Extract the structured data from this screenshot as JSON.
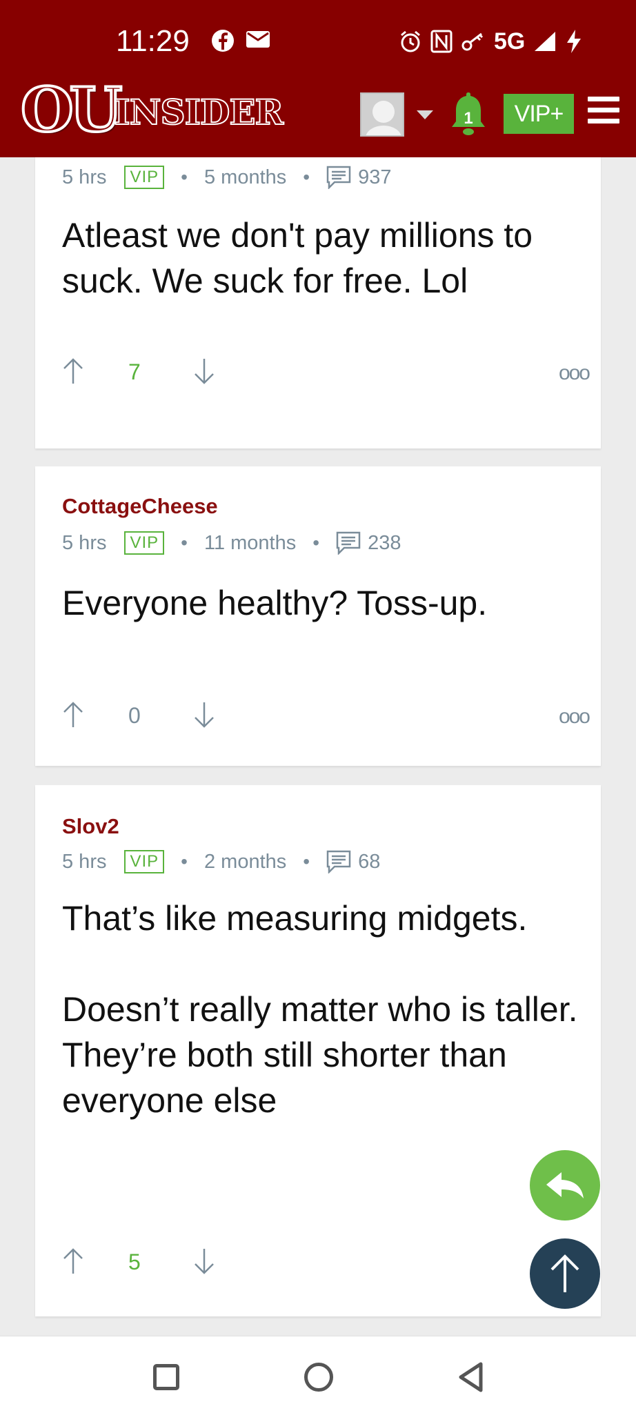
{
  "status_bar": {
    "time": "11:29",
    "left_icons": [
      "facebook-icon",
      "mail-icon"
    ],
    "right_icons": [
      "alarm-icon",
      "nfc-icon",
      "key-icon",
      "5g-signal-icon",
      "charging-icon"
    ],
    "network": "5G"
  },
  "app_bar": {
    "logo_ou": "OU",
    "logo_insider": "INSIDER",
    "notification_count": "1",
    "vip_label": "VIP+",
    "colors": {
      "brand": "#870000",
      "vip_green": "#59b33c"
    }
  },
  "comments": [
    {
      "author": "",
      "posted": "5 hrs",
      "badge": "VIP",
      "tenure": "5 months",
      "post_count": "937",
      "body": "Atleast we don't pay millions to suck. We suck for free. Lol",
      "votes": "7",
      "vote_color": "#59b33c",
      "more_label": "ooo"
    },
    {
      "author": "CottageCheese",
      "posted": "5 hrs",
      "badge": "VIP",
      "tenure": "11 months",
      "post_count": "238",
      "body": "Everyone healthy? Toss-up.",
      "votes": "0",
      "vote_color": "#7a8c99",
      "more_label": "ooo"
    },
    {
      "author": "Slov2",
      "posted": "5 hrs",
      "badge": "VIP",
      "tenure": "2 months",
      "post_count": "68",
      "body": "That’s like measuring midgets.\n\nDoesn’t really matter who is taller. They’re both still shorter than everyone else",
      "votes": "5",
      "vote_color": "#59b33c",
      "more_label": ""
    }
  ],
  "fabs": {
    "reply_icon": "reply-arrow-icon",
    "scroll_top_icon": "arrow-up-icon"
  },
  "nav_bar": {
    "icons": [
      "recents-square-icon",
      "home-circle-icon",
      "back-triangle-icon"
    ]
  }
}
